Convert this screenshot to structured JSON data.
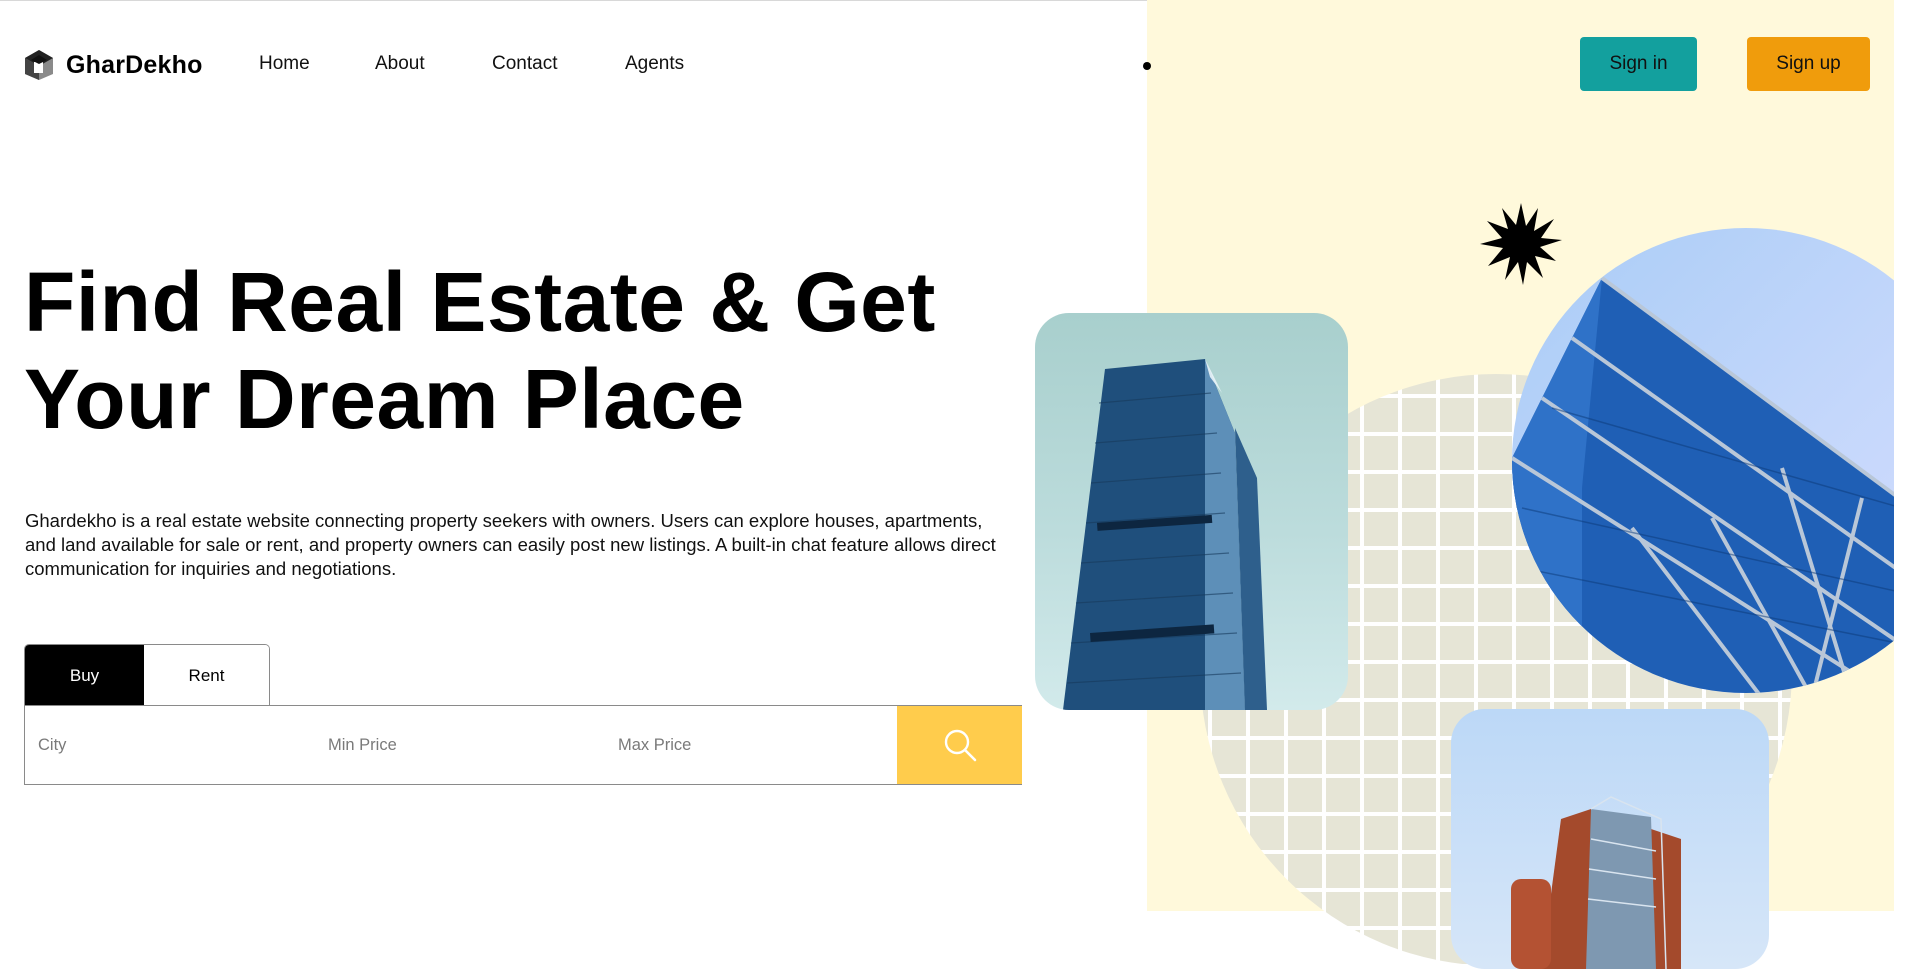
{
  "brand": {
    "name": "GharDekho"
  },
  "nav": {
    "items": [
      {
        "label": "Home"
      },
      {
        "label": "About"
      },
      {
        "label": "Contact"
      },
      {
        "label": "Agents"
      }
    ]
  },
  "auth": {
    "signin_label": "Sign in",
    "signup_label": "Sign up"
  },
  "hero": {
    "title": "Find Real Estate & Get Your Dream Place",
    "description": "Ghardekho is a real estate website connecting property seekers with owners. Users can explore houses, apartments, and land available for sale or rent, and property owners can easily post new listings. A built-in chat feature allows direct communication for inquiries and negotiations."
  },
  "search": {
    "tabs": [
      {
        "label": "Buy",
        "active": true
      },
      {
        "label": "Rent",
        "active": false
      }
    ],
    "city_placeholder": "City",
    "min_price_placeholder": "Min Price",
    "max_price_placeholder": "Max Price",
    "button_icon": "search-icon"
  },
  "colors": {
    "signin_bg": "#13a09e",
    "signup_bg": "#f09c0c",
    "search_button_bg": "#ffcc4c",
    "panel_bg": "#fff9db",
    "active_tab_bg": "#000000"
  },
  "images": [
    {
      "icon": "skyscraper-image"
    },
    {
      "icon": "glass-building-image"
    },
    {
      "icon": "brick-building-image"
    },
    {
      "icon": "starburst-icon"
    }
  ]
}
